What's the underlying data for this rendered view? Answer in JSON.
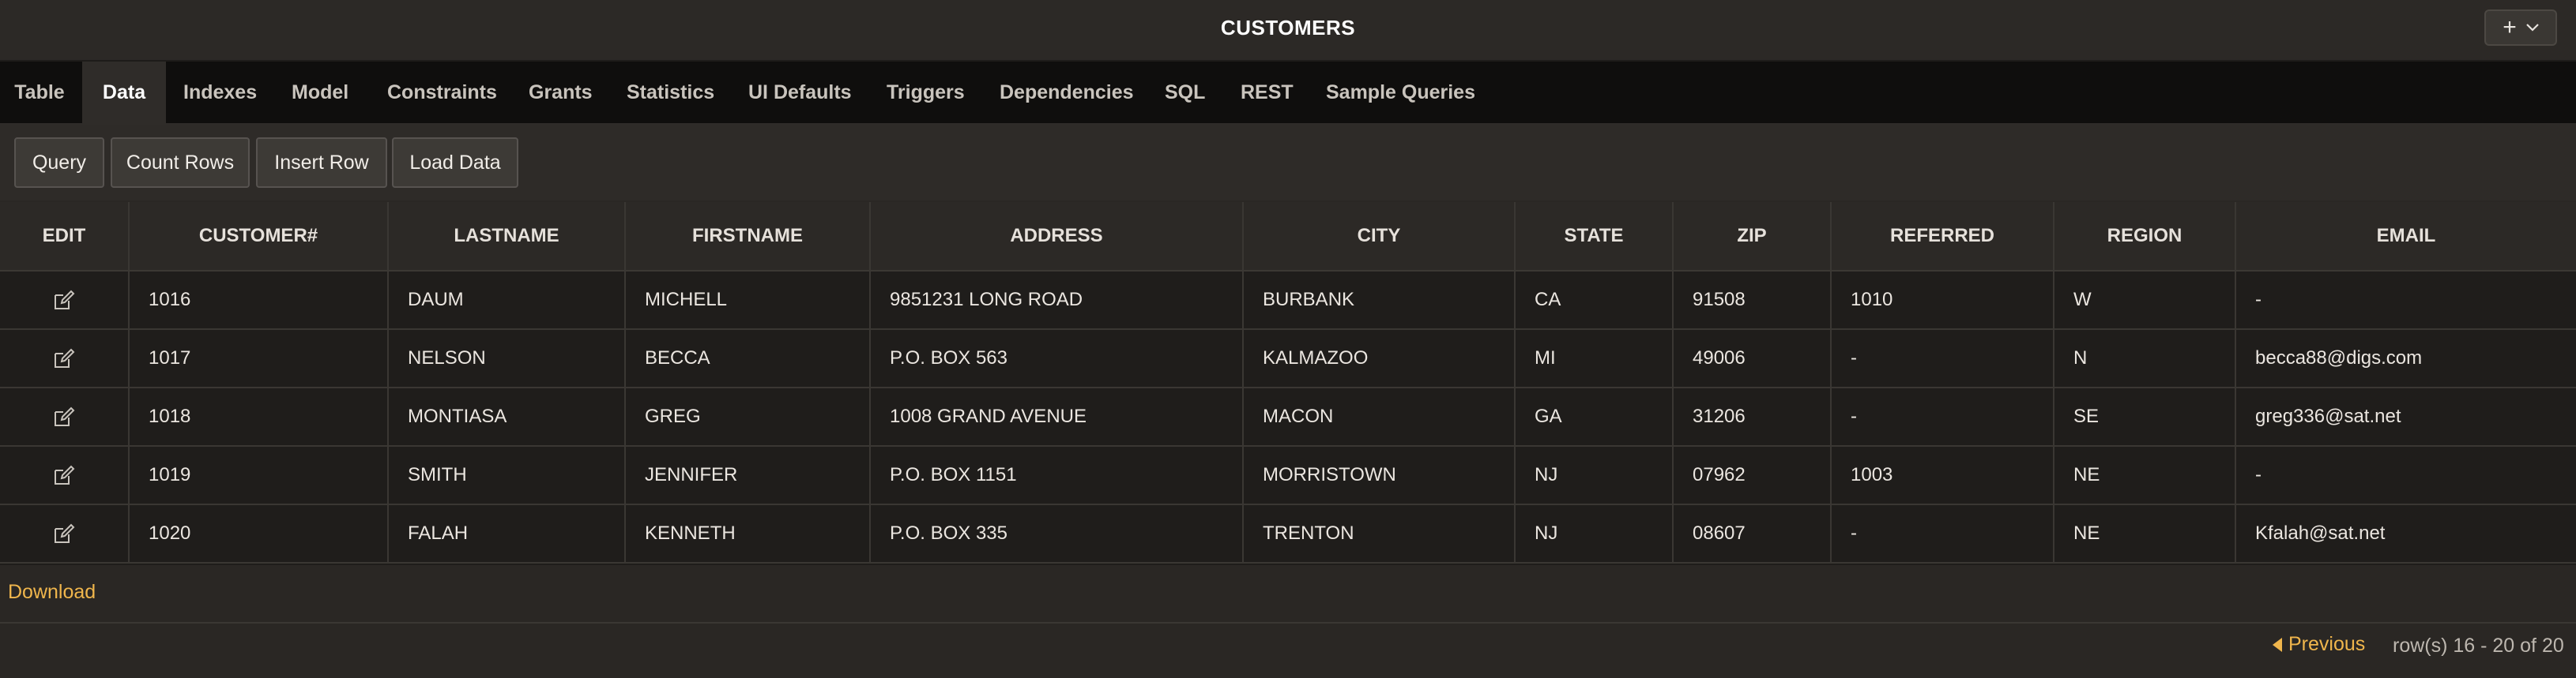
{
  "header": {
    "title": "CUSTOMERS",
    "add_icon": "plus-icon",
    "menu_icon": "chevron-down-icon"
  },
  "tabs": [
    {
      "label": "Table"
    },
    {
      "label": "Data",
      "active": true
    },
    {
      "label": "Indexes"
    },
    {
      "label": "Model"
    },
    {
      "label": "Constraints"
    },
    {
      "label": "Grants"
    },
    {
      "label": "Statistics"
    },
    {
      "label": "UI Defaults"
    },
    {
      "label": "Triggers"
    },
    {
      "label": "Dependencies"
    },
    {
      "label": "SQL"
    },
    {
      "label": "REST"
    },
    {
      "label": "Sample Queries"
    }
  ],
  "toolbar": {
    "query": "Query",
    "count_rows": "Count Rows",
    "insert_row": "Insert Row",
    "load_data": "Load Data"
  },
  "grid": {
    "columns": [
      "EDIT",
      "CUSTOMER#",
      "LASTNAME",
      "FIRSTNAME",
      "ADDRESS",
      "CITY",
      "STATE",
      "ZIP",
      "REFERRED",
      "REGION",
      "EMAIL"
    ],
    "rows": [
      [
        "1016",
        "DAUM",
        "MICHELL",
        "9851231 LONG ROAD",
        "BURBANK",
        "CA",
        "91508",
        "1010",
        "W",
        "-"
      ],
      [
        "1017",
        "NELSON",
        "BECCA",
        "P.O. BOX 563",
        "KALMAZOO",
        "MI",
        "49006",
        "-",
        "N",
        "becca88@digs.com"
      ],
      [
        "1018",
        "MONTIASA",
        "GREG",
        "1008 GRAND AVENUE",
        "MACON",
        "GA",
        "31206",
        "-",
        "SE",
        "greg336@sat.net"
      ],
      [
        "1019",
        "SMITH",
        "JENNIFER",
        "P.O. BOX 1151",
        "MORRISTOWN",
        "NJ",
        "07962",
        "1003",
        "NE",
        "-"
      ],
      [
        "1020",
        "FALAH",
        "KENNETH",
        "P.O. BOX 335",
        "TRENTON",
        "NJ",
        "08607",
        "-",
        "NE",
        "Kfalah@sat.net"
      ]
    ]
  },
  "footer": {
    "download": "Download",
    "previous": "Previous",
    "row_info": "row(s) 16 - 20 of 20"
  },
  "colors": {
    "accent": "#f0b64c",
    "background": "#2a2724",
    "tabbar": "#0f0e0d"
  }
}
